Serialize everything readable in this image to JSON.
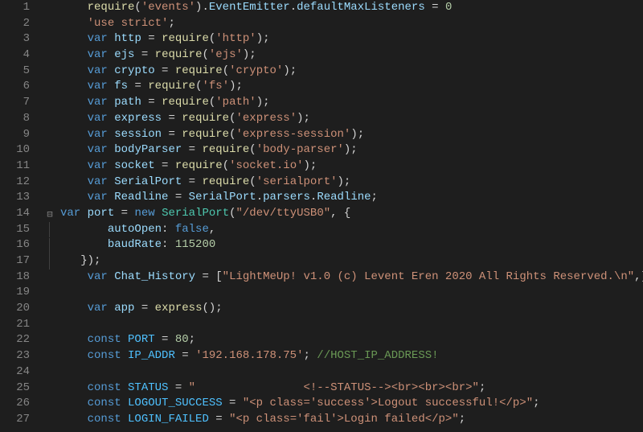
{
  "lines": [
    {
      "num": "1",
      "tokens": [
        [
          "pl",
          "    "
        ],
        [
          "fn",
          "require"
        ],
        [
          "pl",
          "("
        ],
        [
          "str",
          "'events'"
        ],
        [
          "pl",
          ")."
        ],
        [
          "id",
          "EventEmitter"
        ],
        [
          "pl",
          "."
        ],
        [
          "id",
          "defaultMaxListeners"
        ],
        [
          "pl",
          " = "
        ],
        [
          "num",
          "0"
        ]
      ]
    },
    {
      "num": "2",
      "tokens": [
        [
          "pl",
          "    "
        ],
        [
          "str",
          "'use strict'"
        ],
        [
          "pl",
          ";"
        ]
      ]
    },
    {
      "num": "3",
      "tokens": [
        [
          "pl",
          "    "
        ],
        [
          "kw",
          "var"
        ],
        [
          "pl",
          " "
        ],
        [
          "id",
          "http"
        ],
        [
          "pl",
          " = "
        ],
        [
          "fn",
          "require"
        ],
        [
          "pl",
          "("
        ],
        [
          "str",
          "'http'"
        ],
        [
          "pl",
          ");"
        ]
      ]
    },
    {
      "num": "4",
      "tokens": [
        [
          "pl",
          "    "
        ],
        [
          "kw",
          "var"
        ],
        [
          "pl",
          " "
        ],
        [
          "id",
          "ejs"
        ],
        [
          "pl",
          " = "
        ],
        [
          "fn",
          "require"
        ],
        [
          "pl",
          "("
        ],
        [
          "str",
          "'ejs'"
        ],
        [
          "pl",
          ");"
        ]
      ]
    },
    {
      "num": "5",
      "tokens": [
        [
          "pl",
          "    "
        ],
        [
          "kw",
          "var"
        ],
        [
          "pl",
          " "
        ],
        [
          "id",
          "crypto"
        ],
        [
          "pl",
          " = "
        ],
        [
          "fn",
          "require"
        ],
        [
          "pl",
          "("
        ],
        [
          "str",
          "'crypto'"
        ],
        [
          "pl",
          ");"
        ]
      ]
    },
    {
      "num": "6",
      "tokens": [
        [
          "pl",
          "    "
        ],
        [
          "kw",
          "var"
        ],
        [
          "pl",
          " "
        ],
        [
          "id",
          "fs"
        ],
        [
          "pl",
          " = "
        ],
        [
          "fn",
          "require"
        ],
        [
          "pl",
          "("
        ],
        [
          "str",
          "'fs'"
        ],
        [
          "pl",
          ");"
        ]
      ]
    },
    {
      "num": "7",
      "tokens": [
        [
          "pl",
          "    "
        ],
        [
          "kw",
          "var"
        ],
        [
          "pl",
          " "
        ],
        [
          "id",
          "path"
        ],
        [
          "pl",
          " = "
        ],
        [
          "fn",
          "require"
        ],
        [
          "pl",
          "("
        ],
        [
          "str",
          "'path'"
        ],
        [
          "pl",
          ");"
        ]
      ]
    },
    {
      "num": "8",
      "tokens": [
        [
          "pl",
          "    "
        ],
        [
          "kw",
          "var"
        ],
        [
          "pl",
          " "
        ],
        [
          "id",
          "express"
        ],
        [
          "pl",
          " = "
        ],
        [
          "fn",
          "require"
        ],
        [
          "pl",
          "("
        ],
        [
          "str",
          "'express'"
        ],
        [
          "pl",
          ");"
        ]
      ]
    },
    {
      "num": "9",
      "tokens": [
        [
          "pl",
          "    "
        ],
        [
          "kw",
          "var"
        ],
        [
          "pl",
          " "
        ],
        [
          "id",
          "session"
        ],
        [
          "pl",
          " = "
        ],
        [
          "fn",
          "require"
        ],
        [
          "pl",
          "("
        ],
        [
          "str",
          "'express-session'"
        ],
        [
          "pl",
          ");"
        ]
      ]
    },
    {
      "num": "10",
      "tokens": [
        [
          "pl",
          "    "
        ],
        [
          "kw",
          "var"
        ],
        [
          "pl",
          " "
        ],
        [
          "id",
          "bodyParser"
        ],
        [
          "pl",
          " = "
        ],
        [
          "fn",
          "require"
        ],
        [
          "pl",
          "("
        ],
        [
          "str",
          "'body-parser'"
        ],
        [
          "pl",
          ");"
        ]
      ]
    },
    {
      "num": "11",
      "tokens": [
        [
          "pl",
          "    "
        ],
        [
          "kw",
          "var"
        ],
        [
          "pl",
          " "
        ],
        [
          "id",
          "socket"
        ],
        [
          "pl",
          " = "
        ],
        [
          "fn",
          "require"
        ],
        [
          "pl",
          "("
        ],
        [
          "str",
          "'socket.io'"
        ],
        [
          "pl",
          ");"
        ]
      ]
    },
    {
      "num": "12",
      "tokens": [
        [
          "pl",
          "    "
        ],
        [
          "kw",
          "var"
        ],
        [
          "pl",
          " "
        ],
        [
          "id",
          "SerialPort"
        ],
        [
          "pl",
          " = "
        ],
        [
          "fn",
          "require"
        ],
        [
          "pl",
          "("
        ],
        [
          "str",
          "'serialport'"
        ],
        [
          "pl",
          ");"
        ]
      ]
    },
    {
      "num": "13",
      "tokens": [
        [
          "pl",
          "    "
        ],
        [
          "kw",
          "var"
        ],
        [
          "pl",
          " "
        ],
        [
          "id",
          "Readline"
        ],
        [
          "pl",
          " = "
        ],
        [
          "id",
          "SerialPort"
        ],
        [
          "pl",
          "."
        ],
        [
          "id",
          "parsers"
        ],
        [
          "pl",
          "."
        ],
        [
          "id",
          "Readline"
        ],
        [
          "pl",
          ";"
        ]
      ]
    },
    {
      "num": "14",
      "fold": true,
      "tokens": [
        [
          "kw",
          "var"
        ],
        [
          "pl",
          " "
        ],
        [
          "id",
          "port"
        ],
        [
          "pl",
          " = "
        ],
        [
          "kw",
          "new"
        ],
        [
          "pl",
          " "
        ],
        [
          "cls",
          "SerialPort"
        ],
        [
          "pl",
          "("
        ],
        [
          "str",
          "\"/dev/ttyUSB0\""
        ],
        [
          "pl",
          ", {"
        ]
      ]
    },
    {
      "num": "15",
      "in": true,
      "tokens": [
        [
          "pl",
          "       "
        ],
        [
          "id",
          "autoOpen"
        ],
        [
          "pl",
          ": "
        ],
        [
          "kw",
          "false"
        ],
        [
          "pl",
          ","
        ]
      ]
    },
    {
      "num": "16",
      "in": true,
      "tokens": [
        [
          "pl",
          "       "
        ],
        [
          "id",
          "baudRate"
        ],
        [
          "pl",
          ": "
        ],
        [
          "num",
          "115200"
        ]
      ]
    },
    {
      "num": "17",
      "in": true,
      "tokens": [
        [
          "pl",
          "   });"
        ]
      ]
    },
    {
      "num": "18",
      "tokens": [
        [
          "pl",
          "    "
        ],
        [
          "kw",
          "var"
        ],
        [
          "pl",
          " "
        ],
        [
          "id",
          "Chat_History"
        ],
        [
          "pl",
          " = ["
        ],
        [
          "str",
          "\"LightMeUp! v1.0 (c) Levent Eren 2020 All Rights Reserved.\\n\""
        ],
        [
          "pl",
          ",];"
        ]
      ]
    },
    {
      "num": "19",
      "tokens": [
        [
          "pl",
          ""
        ]
      ]
    },
    {
      "num": "20",
      "tokens": [
        [
          "pl",
          "    "
        ],
        [
          "kw",
          "var"
        ],
        [
          "pl",
          " "
        ],
        [
          "id",
          "app"
        ],
        [
          "pl",
          " = "
        ],
        [
          "fn",
          "express"
        ],
        [
          "pl",
          "();"
        ]
      ]
    },
    {
      "num": "21",
      "tokens": [
        [
          "pl",
          ""
        ]
      ]
    },
    {
      "num": "22",
      "tokens": [
        [
          "pl",
          "    "
        ],
        [
          "kw",
          "const"
        ],
        [
          "pl",
          " "
        ],
        [
          "const",
          "PORT"
        ],
        [
          "pl",
          " = "
        ],
        [
          "num",
          "80"
        ],
        [
          "pl",
          ";"
        ]
      ]
    },
    {
      "num": "23",
      "tokens": [
        [
          "pl",
          "    "
        ],
        [
          "kw",
          "const"
        ],
        [
          "pl",
          " "
        ],
        [
          "const",
          "IP_ADDR"
        ],
        [
          "pl",
          " = "
        ],
        [
          "str",
          "'192.168.178.75'"
        ],
        [
          "pl",
          "; "
        ],
        [
          "cmnt",
          "//HOST_IP_ADDRESS!"
        ]
      ]
    },
    {
      "num": "24",
      "tokens": [
        [
          "pl",
          ""
        ]
      ]
    },
    {
      "num": "25",
      "tokens": [
        [
          "pl",
          "    "
        ],
        [
          "kw",
          "const"
        ],
        [
          "pl",
          " "
        ],
        [
          "const",
          "STATUS"
        ],
        [
          "pl",
          " = "
        ],
        [
          "str",
          "\"                <!--STATUS--><br><br><br>\""
        ],
        [
          "pl",
          ";"
        ]
      ]
    },
    {
      "num": "26",
      "tokens": [
        [
          "pl",
          "    "
        ],
        [
          "kw",
          "const"
        ],
        [
          "pl",
          " "
        ],
        [
          "const",
          "LOGOUT_SUCCESS"
        ],
        [
          "pl",
          " = "
        ],
        [
          "str",
          "\"<p class='success'>Logout successful!</p>\""
        ],
        [
          "pl",
          ";"
        ]
      ]
    },
    {
      "num": "27",
      "tokens": [
        [
          "pl",
          "    "
        ],
        [
          "kw",
          "const"
        ],
        [
          "pl",
          " "
        ],
        [
          "const",
          "LOGIN_FAILED"
        ],
        [
          "pl",
          " = "
        ],
        [
          "str",
          "\"<p class='fail'>Login failed</p>\""
        ],
        [
          "pl",
          ";"
        ]
      ]
    }
  ]
}
